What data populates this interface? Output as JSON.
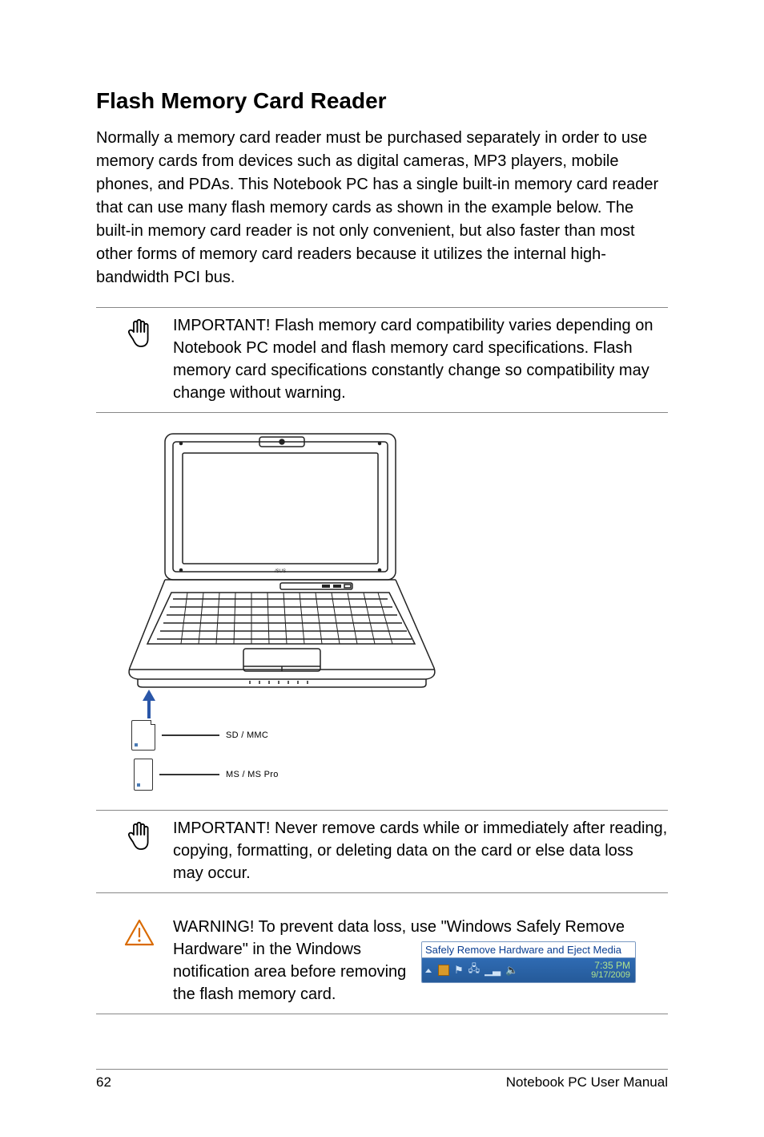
{
  "heading": "Flash Memory Card Reader",
  "intro": "Normally a memory card reader must be purchased separately in order to use memory cards from devices such as digital cameras, MP3 players, mobile phones, and PDAs. This Notebook PC has a single built-in memory card reader that can use many flash memory cards as shown in the example below. The built-in memory card reader is not only convenient, but also faster than most other forms of memory card readers because it utilizes the internal high-bandwidth PCI bus.",
  "important1": "IMPORTANT! Flash memory card compatibility varies depending on Notebook PC model and flash memory card specifications. Flash memory card specifications constantly change so compatibility may change without warning.",
  "cards": {
    "sd": "SD / MMC",
    "ms": "MS / MS Pro"
  },
  "important2": "IMPORTANT!  Never remove cards while or immediately after reading, copying, formatting, or deleting data on the card or else data loss may occur.",
  "warning_line1": "WARNING! To prevent data loss, use \"Windows Safely Remove",
  "warning_line2": "Hardware\" in the Windows notification area before removing the flash memory card.",
  "tray": {
    "tooltip": "Safely Remove Hardware and Eject Media",
    "time": "7:35 PM",
    "date": "9/17/2009"
  },
  "footer": {
    "page": "62",
    "label": "Notebook PC User Manual"
  }
}
